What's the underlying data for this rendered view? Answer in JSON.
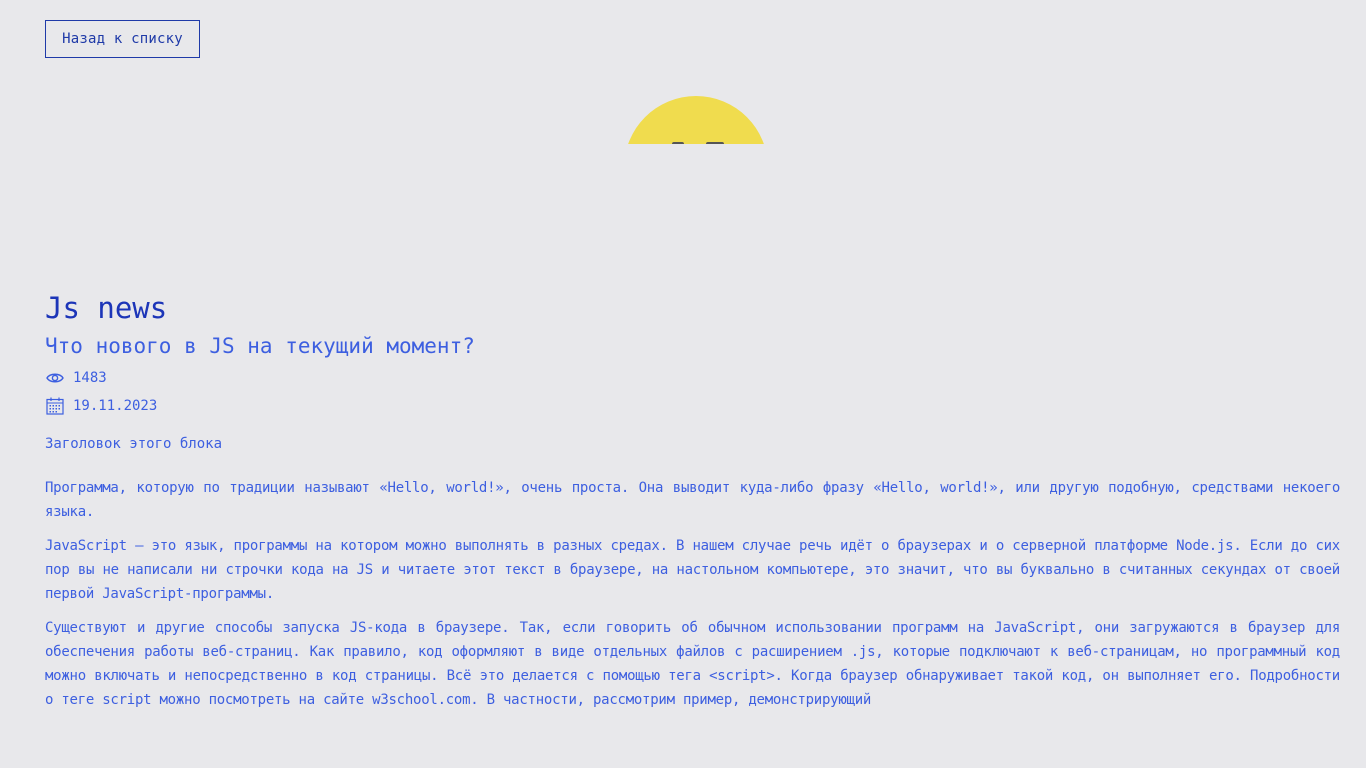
{
  "back_button": {
    "label": "Назад к списку"
  },
  "hero": {
    "icon": "js-news-logo-icon",
    "colors": {
      "sun": "#f0dc4e"
    }
  },
  "article": {
    "title": "Js news",
    "subtitle": "Что нового в JS на текущий момент?",
    "views": "1483",
    "date": "19.11.2023",
    "block_heading": "Заголовок этого блока",
    "paragraphs": [
      "Программа, которую по традиции называют «Hello, world!», очень проста. Она выводит куда-либо фразу «Hello, world!», или другую подобную, средствами некоего языка.",
      "JavaScript — это язык, программы на котором можно выполнять в разных средах. В нашем случае речь идёт о браузерах и о серверной платформе Node.js. Если до сих пор вы не написали ни строчки кода на JS и читаете этот текст в браузере, на настольном компьютере, это значит, что вы буквально в считанных секундах от своей первой JavaScript-программы.",
      "Существуют и другие способы запуска JS-кода в браузере. Так, если говорить об обычном использовании программ на JavaScript, они загружаются в браузер для обеспечения работы веб-страниц. Как правило, код оформляют в виде отдельных файлов с расширением .js, которые подключают к веб-страницам, но программный код можно включать и непосредственно в код страницы. Всё это делается с помощью тега <script>. Когда браузер обнаруживает такой код, он выполняет его. Подробности о теге script можно посмотреть на сайте w3school.com. В частности, рассмотрим пример, демонстрирующий"
    ]
  },
  "colors": {
    "background": "#e8e8eb",
    "title": "#1c35b8",
    "text": "#3d5fe0",
    "button_border": "#1f3aa8"
  }
}
